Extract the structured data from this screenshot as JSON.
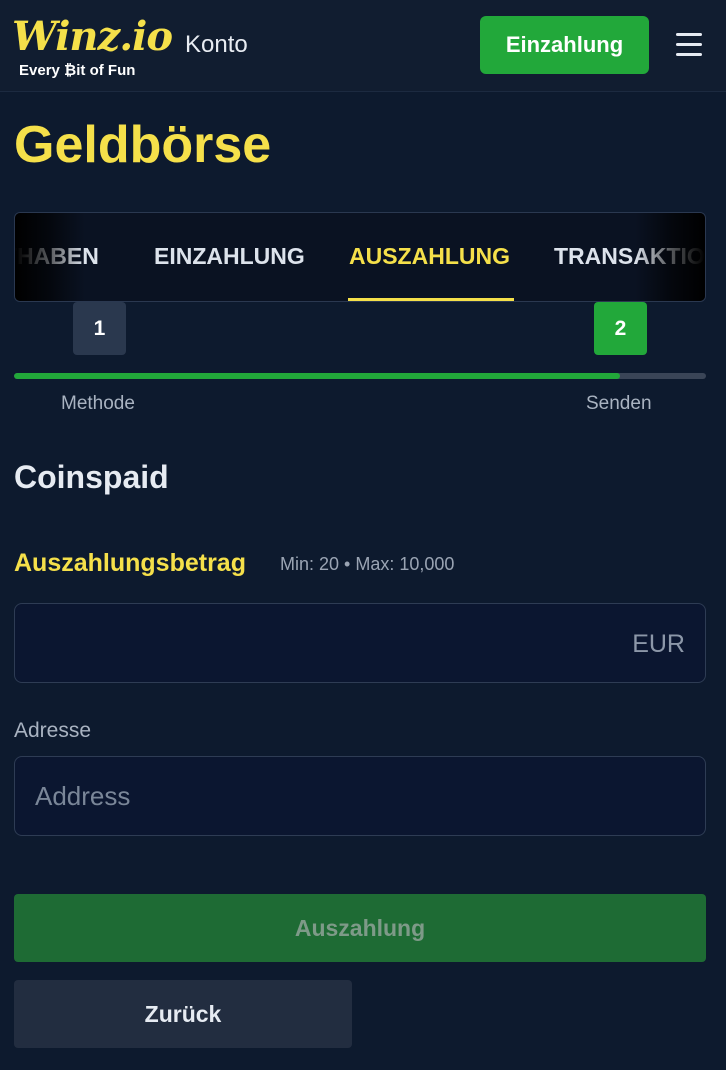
{
  "header": {
    "logo_text": "Winz.io",
    "logo_tagline": "Every ₿it of Fun",
    "nav_label": "Konto",
    "deposit_button": "Einzahlung",
    "menu_icon": "hamburger-menu-icon"
  },
  "page": {
    "title": "Geldbörse"
  },
  "tabs": [
    {
      "label": "THABEN",
      "active": false
    },
    {
      "label": "EINZAHLUNG",
      "active": false
    },
    {
      "label": "AUSZAHLUNG",
      "active": true
    },
    {
      "label": "TRANSAKTIO",
      "active": false
    }
  ],
  "steps": {
    "items": [
      {
        "number": "1",
        "label": "Methode"
      },
      {
        "number": "2",
        "label": "Senden"
      }
    ],
    "progress_percent": 87.5
  },
  "form": {
    "method_title": "Coinspaid",
    "amount_label": "Auszahlungsbetrag",
    "amount_limits": "Min: 20 • Max: 10,000",
    "amount_value": "",
    "currency": "EUR",
    "address_label": "Adresse",
    "address_placeholder": "Address",
    "submit_button": "Auszahlung",
    "back_button": "Zurück"
  },
  "colors": {
    "background": "#0d1a2e",
    "accent_yellow": "#f5e04a",
    "accent_green": "#22a83a",
    "disabled_green": "#1e6b34"
  }
}
